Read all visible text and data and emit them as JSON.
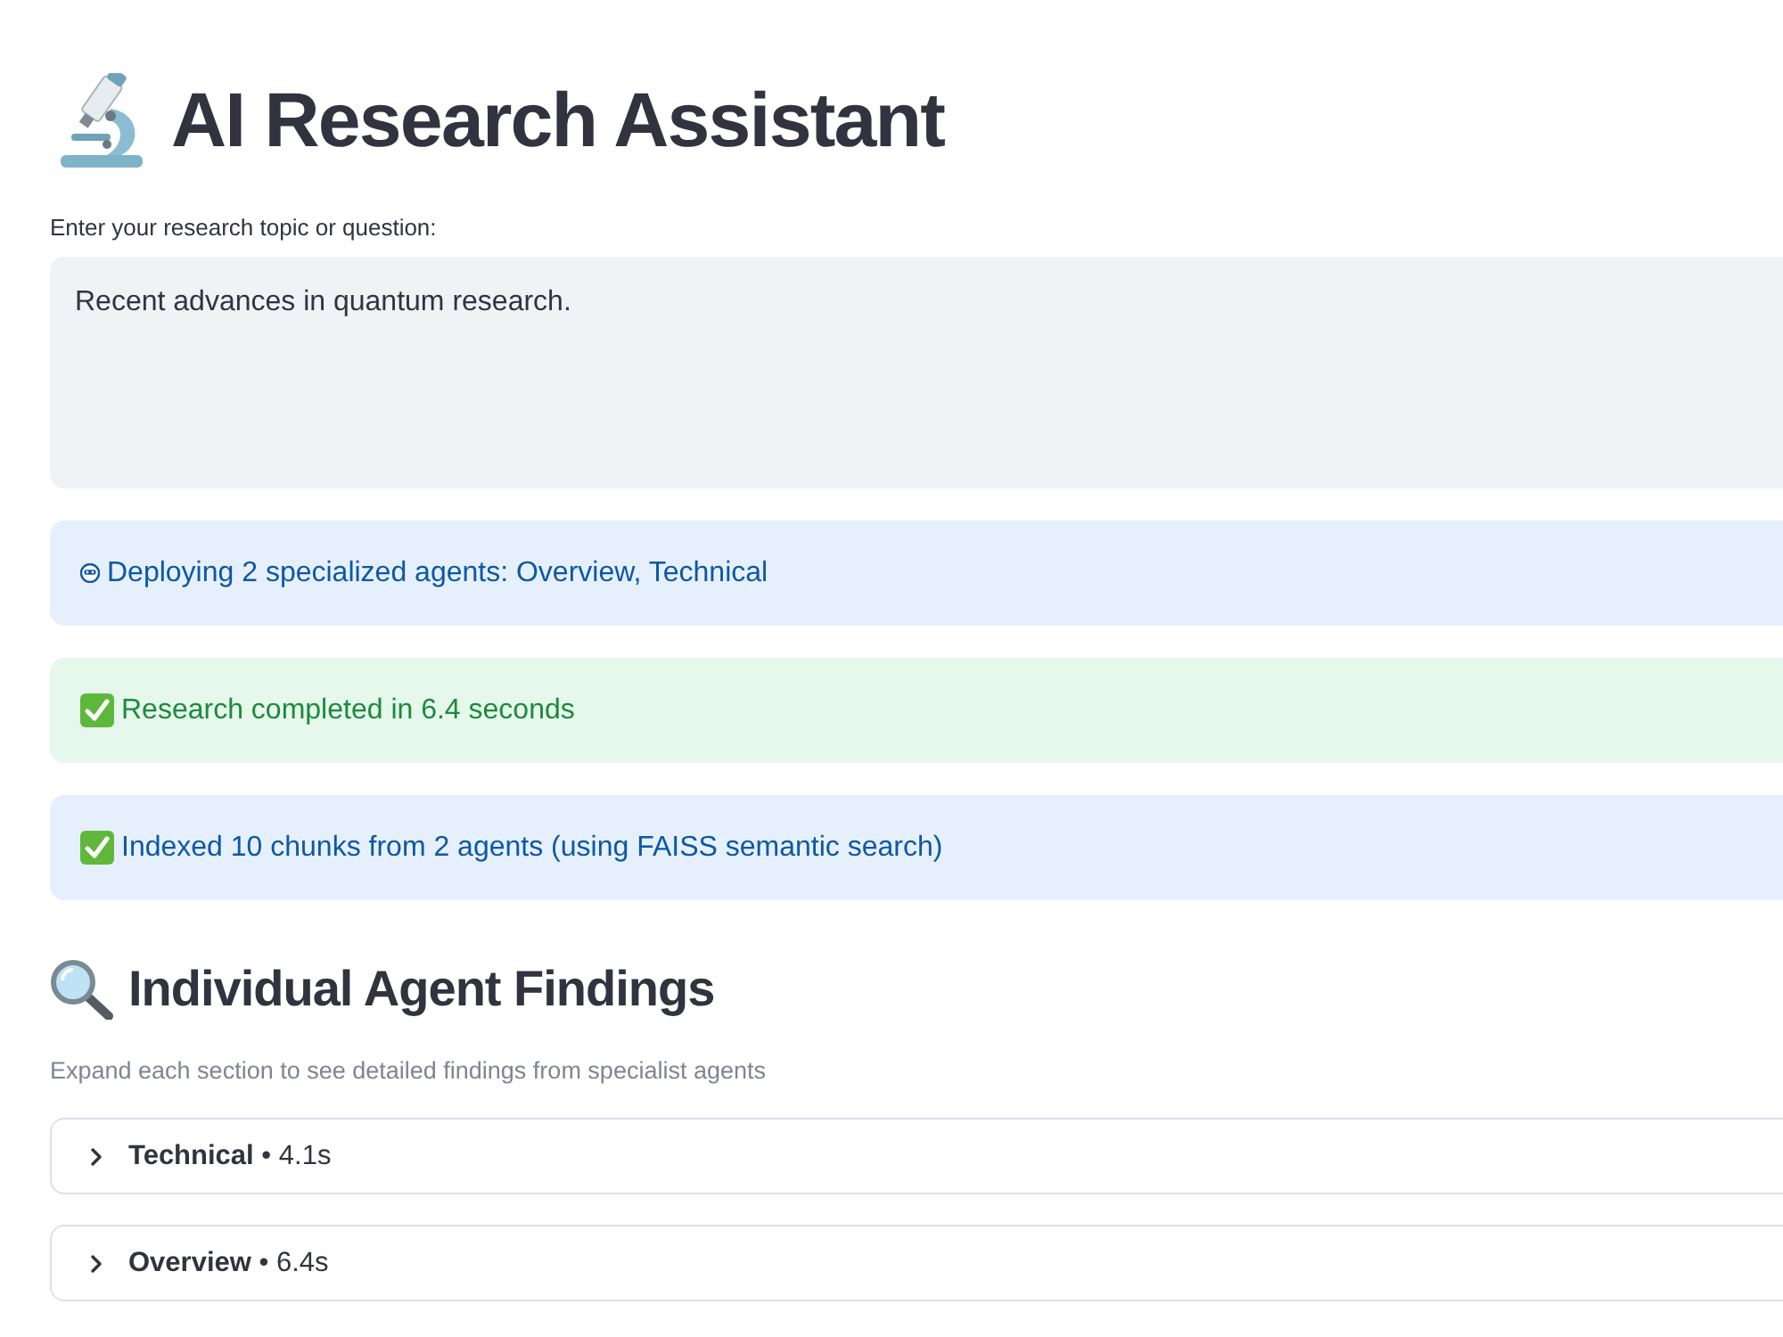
{
  "title": {
    "text": "AI Research Assistant"
  },
  "query": {
    "label": "Enter your research topic or question:",
    "value": "Recent advances in quantum research."
  },
  "alerts": [
    {
      "kind": "info",
      "done": false,
      "text": "Deploying 2 specialized agents: Overview, Technical"
    },
    {
      "kind": "success",
      "done": true,
      "text": "Research completed in 6.4 seconds"
    },
    {
      "kind": "info",
      "done": true,
      "text": "Indexed 10 chunks from 2 agents (using FAISS semantic search)"
    }
  ],
  "findings": {
    "heading": "Individual Agent Findings",
    "caption": "Expand each section to see detailed findings from specialist agents",
    "agents": [
      {
        "name": "Technical",
        "detail": "• 4.1s",
        "expanded": false
      },
      {
        "name": "Overview",
        "detail": "• 6.4s",
        "expanded": false
      }
    ]
  }
}
